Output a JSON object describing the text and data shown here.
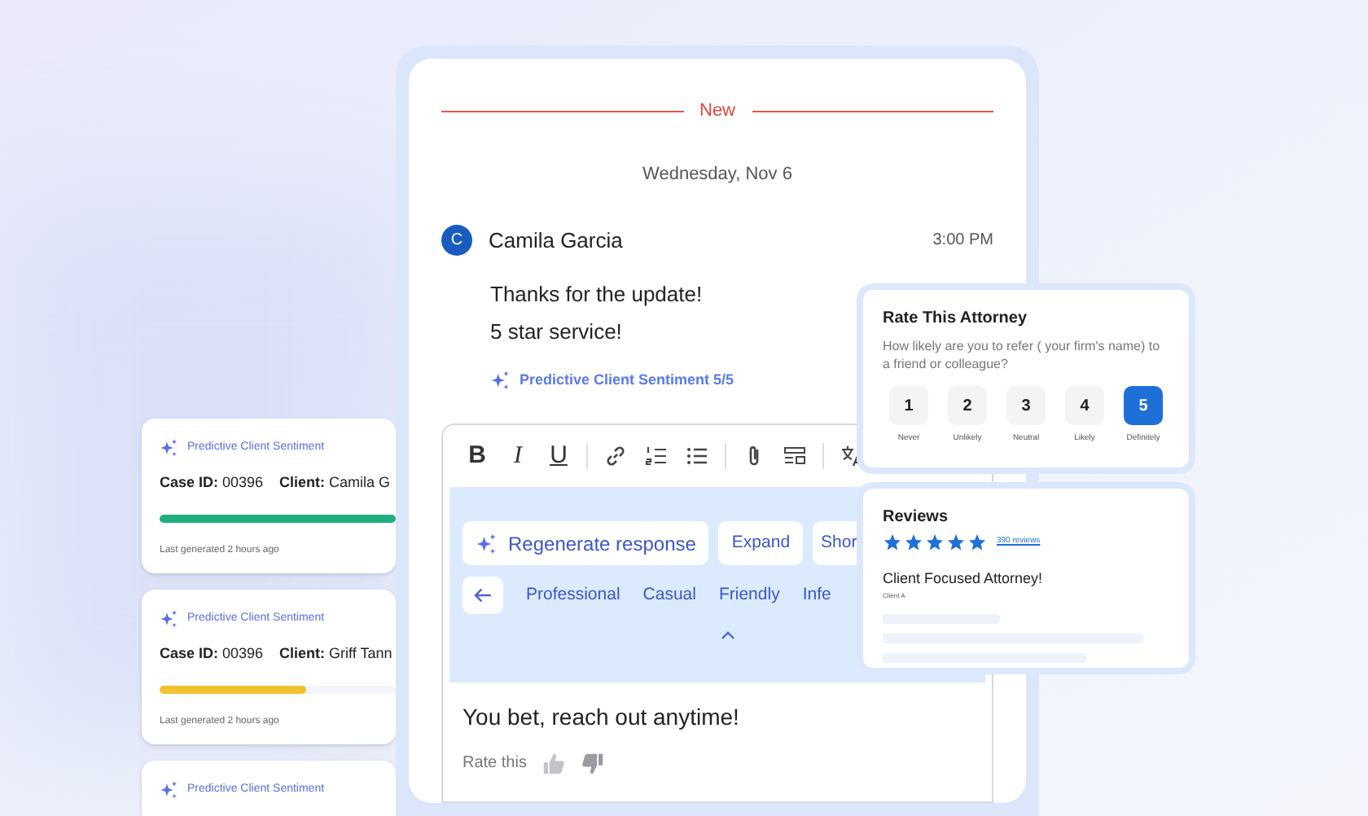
{
  "case_cards": [
    {
      "header": "Predictive Client Sentiment",
      "case_label": "Case ID:",
      "case_id": "00396",
      "client_label": "Client:",
      "client": "Camila G",
      "level": 1,
      "color": "#1fae7e",
      "footer": "Last generated 2 hours ago"
    },
    {
      "header": "Predictive Client Sentiment",
      "case_label": "Case ID:",
      "case_id": "00396",
      "client_label": "Client:",
      "client": "Griff Tann",
      "level": 0.62,
      "color": "#f2c12e",
      "footer": "Last generated 2 hours ago"
    },
    {
      "header": "Predictive Client Sentiment"
    }
  ],
  "chat": {
    "divider": "New",
    "date": "Wednesday, Nov 6",
    "message": {
      "avatar": "C",
      "sender": "Camila Garcia",
      "time": "3:00 PM",
      "lines": [
        "Thanks for the update!",
        "5 star service!"
      ],
      "sentiment": "Predictive Client Sentiment 5/5"
    }
  },
  "editor": {
    "toolbar": [
      {
        "kind": "text",
        "label": "B"
      },
      {
        "kind": "text",
        "label": "I"
      },
      {
        "kind": "text",
        "label": "U"
      },
      {
        "kind": "sep"
      },
      {
        "kind": "link"
      },
      {
        "kind": "numbered"
      },
      {
        "kind": "bulleted"
      },
      {
        "kind": "sep"
      },
      {
        "kind": "attach"
      },
      {
        "kind": "template"
      },
      {
        "kind": "sep"
      },
      {
        "kind": "translate"
      }
    ],
    "actions": [
      {
        "label": "Regenerate response",
        "kind": "sparkle"
      },
      {
        "label": "Expand",
        "kind": "plain"
      },
      {
        "label": "Shor",
        "kind": "plain"
      }
    ],
    "tones": [
      "Professional",
      "Casual",
      "Friendly",
      "Infe"
    ],
    "reply": "You bet, reach out anytime!",
    "rate_label": "Rate this"
  },
  "rate_card": {
    "title": "Rate This Attorney",
    "question": "How likely are you to refer ( your firm's name) to a friend or colleague?",
    "options": [
      {
        "value": "1",
        "label": "Never",
        "selected": false
      },
      {
        "value": "2",
        "label": "Unlikely",
        "selected": false
      },
      {
        "value": "3",
        "label": "Neutral",
        "selected": false
      },
      {
        "value": "4",
        "label": "Likely",
        "selected": false
      },
      {
        "value": "5",
        "label": "Definitely",
        "selected": true
      }
    ]
  },
  "reviews_card": {
    "title": "Reviews",
    "stars": 5,
    "count": "390 reviews",
    "review_title": "Client Focused Attorney!",
    "reviewer": "Client A"
  }
}
